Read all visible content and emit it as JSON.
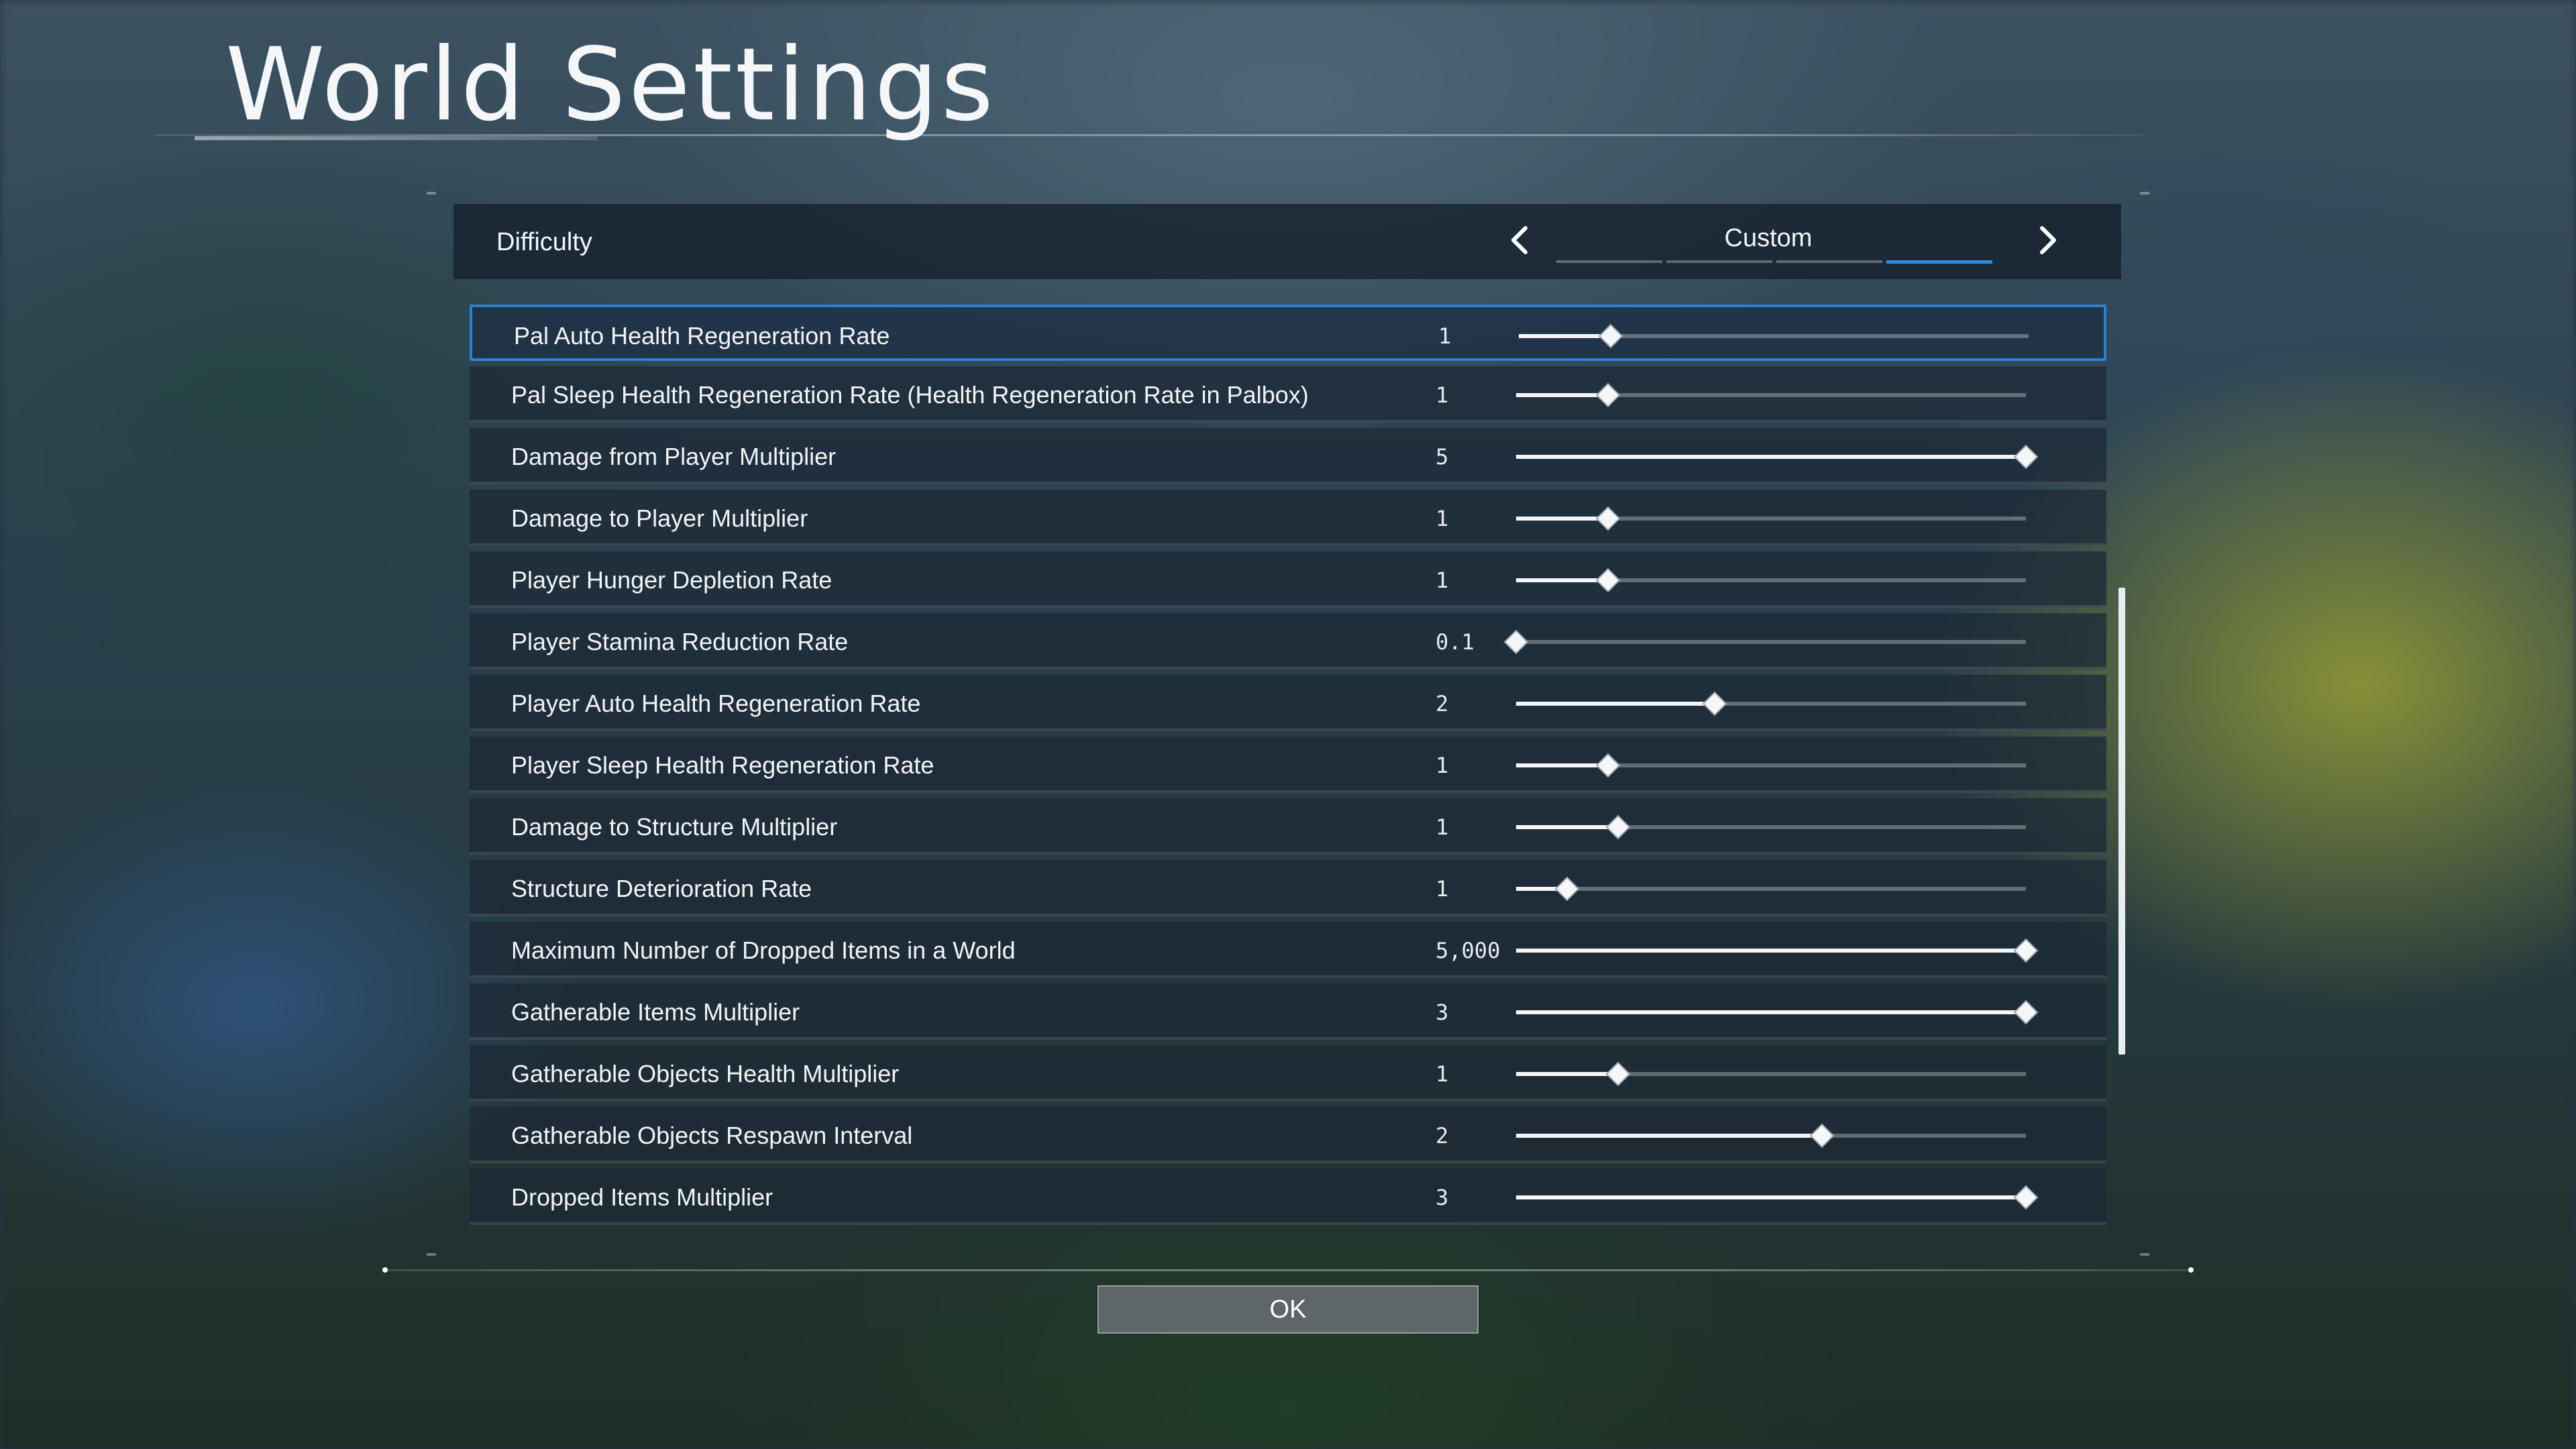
{
  "title": "World Settings",
  "difficulty": {
    "label": "Difficulty",
    "value": "Custom",
    "segments": 4,
    "active_segment": 4
  },
  "settings": [
    {
      "label": "Pal Auto Health Regeneration Rate",
      "value": "1",
      "level": 0.18
    },
    {
      "label": "Pal Sleep Health Regeneration Rate (Health Regeneration Rate in Palbox)",
      "value": "1",
      "level": 0.18
    },
    {
      "label": "Damage from Player Multiplier",
      "value": "5",
      "level": 1.0
    },
    {
      "label": "Damage to Player Multiplier",
      "value": "1",
      "level": 0.18
    },
    {
      "label": "Player Hunger Depletion Rate",
      "value": "1",
      "level": 0.18
    },
    {
      "label": "Player Stamina Reduction Rate",
      "value": "0.1",
      "level": 0.0
    },
    {
      "label": "Player Auto Health Regeneration Rate",
      "value": "2",
      "level": 0.39
    },
    {
      "label": "Player Sleep Health Regeneration Rate",
      "value": "1",
      "level": 0.18
    },
    {
      "label": "Damage to Structure Multiplier",
      "value": "1",
      "level": 0.2
    },
    {
      "label": "Structure Deterioration Rate",
      "value": "1",
      "level": 0.1
    },
    {
      "label": "Maximum Number of Dropped Items in a World",
      "value": "5,000",
      "level": 1.0
    },
    {
      "label": "Gatherable Items Multiplier",
      "value": "3",
      "level": 1.0
    },
    {
      "label": "Gatherable Objects Health Multiplier",
      "value": "1",
      "level": 0.2
    },
    {
      "label": "Gatherable Objects Respawn Interval",
      "value": "2",
      "level": 0.6
    },
    {
      "label": "Dropped Items Multiplier",
      "value": "3",
      "level": 1.0
    }
  ],
  "ok_label": "OK",
  "colors": {
    "accent": "#2f8de0",
    "row_bg": "#1c2836",
    "text": "#f2f4f6"
  },
  "icons": {
    "prev": "chevron-left-icon",
    "next": "chevron-right-icon",
    "handle": "diamond-handle-icon"
  }
}
